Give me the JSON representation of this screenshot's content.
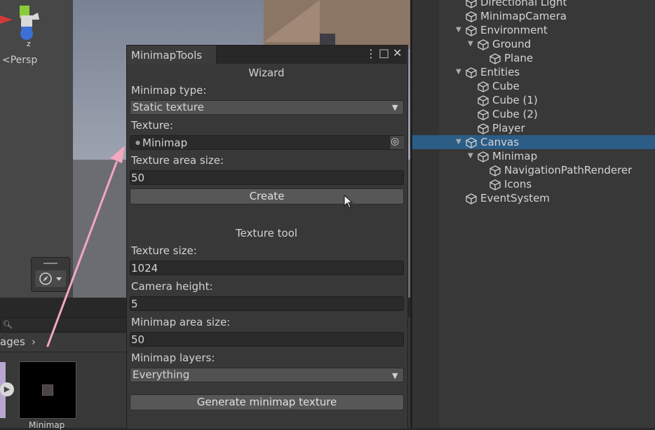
{
  "scene_view": {
    "projection_label": "<Persp",
    "gizmo_axis_label": "z"
  },
  "project_panel": {
    "breadcrumb": "ages",
    "asset_label": "Minimap"
  },
  "hierarchy": {
    "selected_color": "#2c5d87",
    "items": [
      {
        "label": "Directional Light"
      },
      {
        "label": "MinimapCamera"
      },
      {
        "label": "Environment"
      },
      {
        "label": "Ground"
      },
      {
        "label": "Plane"
      },
      {
        "label": "Entities"
      },
      {
        "label": "Cube"
      },
      {
        "label": "Cube (1)"
      },
      {
        "label": "Cube (2)"
      },
      {
        "label": "Player"
      },
      {
        "label": "Canvas"
      },
      {
        "label": "Minimap"
      },
      {
        "label": "NavigationPathRenderer"
      },
      {
        "label": "Icons"
      },
      {
        "label": "EventSystem"
      }
    ]
  },
  "tool_window": {
    "tab_title": "MinimapTools",
    "wizard": {
      "section_title": "Wizard",
      "minimap_type_label": "Minimap type:",
      "minimap_type_value": "Static texture",
      "texture_label": "Texture:",
      "texture_value": "Minimap",
      "texture_area_size_label": "Texture area size:",
      "texture_area_size_value": "50",
      "create_button": "Create"
    },
    "texture_tool": {
      "section_title": "Texture tool",
      "texture_size_label": "Texture size:",
      "texture_size_value": "1024",
      "camera_height_label": "Camera height:",
      "camera_height_value": "5",
      "minimap_area_size_label": "Minimap area size:",
      "minimap_area_size_value": "50",
      "minimap_layers_label": "Minimap layers:",
      "minimap_layers_value": "Everything",
      "generate_button": "Generate minimap texture"
    }
  },
  "colors": {
    "annotation_arrow": "#f4a7c0",
    "selection": "#2c5d87"
  }
}
